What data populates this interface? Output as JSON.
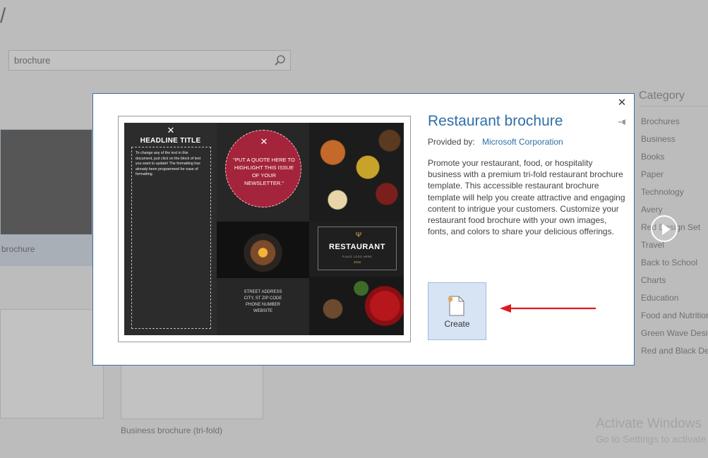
{
  "background": {
    "partial_title": "/",
    "search": {
      "value": "brochure"
    },
    "category": {
      "title": "Category",
      "items": [
        "Brochures",
        "Business",
        "Books",
        "Paper",
        "Technology",
        "Avery",
        "Red Design Set",
        "Travel",
        "Back to School",
        "Charts",
        "Education",
        "Food and Nutrition",
        "Green Wave Design",
        "Red and Black Des"
      ]
    },
    "left_caption": "brochure",
    "bottom_caption": "Business brochure (tri-fold)",
    "activate": {
      "line1": "Activate Windows",
      "line2": "Go to Settings to activate"
    }
  },
  "dialog": {
    "title": "Restaurant brochure",
    "provided_label": "Provided by:",
    "provider": "Microsoft Corporation",
    "description": "Promote your restaurant, food, or hospitality business with a premium tri-fold restaurant brochure template. This accessible restaurant brochure template will help you create attractive and engaging content to intrigue your customers. Customize your restaurant food brochure with your own images, fonts, and colors to share your delicious offerings.",
    "create_label": "Create",
    "close_glyph": "✕",
    "preview": {
      "headline": "HEADLINE TITLE",
      "body": "To change any of the text in this document, just click on the block of text you want to update! The formatting has already been programmed for ease of formatting.",
      "quote": "\"PUT A QUOTE HERE TO HIGHLIGHT THIS ISSUE OF YOUR NEWSLETTER.\"",
      "address": [
        "STREET ADDRESS",
        "CITY, ST ZIP CODE",
        "PHONE NUMBER",
        "WEBSITE"
      ],
      "logo_word": "RESTAURANT",
      "logo_tagline": "PLACE LOGO HERE",
      "logo_year": "2019"
    }
  },
  "colors": {
    "accent": "#2f6fa7",
    "brochure_red": "#a4243b",
    "arrow": "#e0191e"
  }
}
